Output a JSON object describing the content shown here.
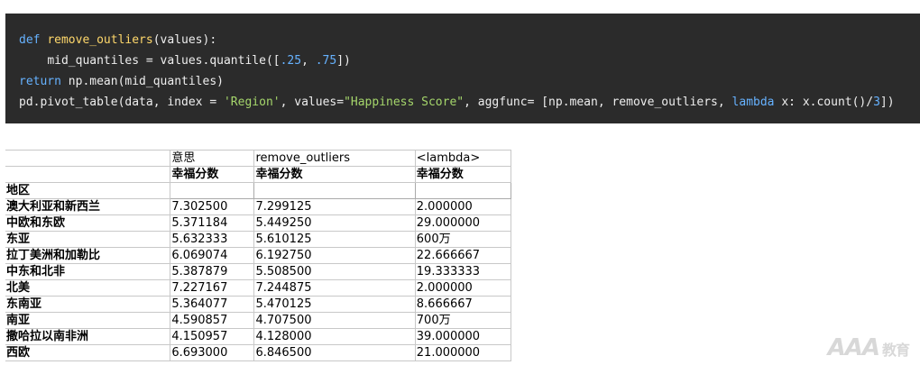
{
  "code": {
    "line1": {
      "kw": "def",
      "fn": "remove_outliers",
      "rest": "(values):"
    },
    "line2": {
      "indent": "    ",
      "a": "mid_quantiles = values.quantile([",
      "n1": ".25",
      "c": ", ",
      "n2": ".75",
      "d": "])"
    },
    "line3": {
      "kw": "return",
      "rest": " np.mean(mid_quantiles)"
    },
    "line4": {
      "a": "pd.pivot_table(data, index = ",
      "s1": "'Region'",
      "b": ", values=",
      "s2": "\"Happiness Score\"",
      "c": ", aggfunc= [np.mean, remove_outliers, ",
      "kw": "lambda",
      "d": " x: x.count()/",
      "n": "3",
      "e": "])"
    }
  },
  "table": {
    "col_headers": [
      "",
      "意思",
      "remove_outliers",
      "<lambda>"
    ],
    "sub_headers": [
      "",
      "幸福分数",
      "幸福分数",
      "幸福分数"
    ],
    "index_name": "地区",
    "rows": [
      [
        "澳大利亚和新西兰",
        "7.302500",
        "7.299125",
        "2.000000"
      ],
      [
        "中欧和东欧",
        "5.371184",
        "5.449250",
        "29.000000"
      ],
      [
        "东亚",
        "5.632333",
        "5.610125",
        "600万"
      ],
      [
        "拉丁美洲和加勒比",
        "6.069074",
        "6.192750",
        "22.666667"
      ],
      [
        "中东和北非",
        "5.387879",
        "5.508500",
        "19.333333"
      ],
      [
        "北美",
        "7.227167",
        "7.244875",
        "2.000000"
      ],
      [
        "东南亚",
        "5.364077",
        "5.470125",
        "8.666667"
      ],
      [
        "南亚",
        "4.590857",
        "4.707500",
        "700万"
      ],
      [
        "撒哈拉以南非洲",
        "4.150957",
        "4.128000",
        "39.000000"
      ],
      [
        "西欧",
        "6.693000",
        "6.846500",
        "21.000000"
      ]
    ]
  },
  "watermark": {
    "logo": "AAA",
    "sub": "教育"
  }
}
